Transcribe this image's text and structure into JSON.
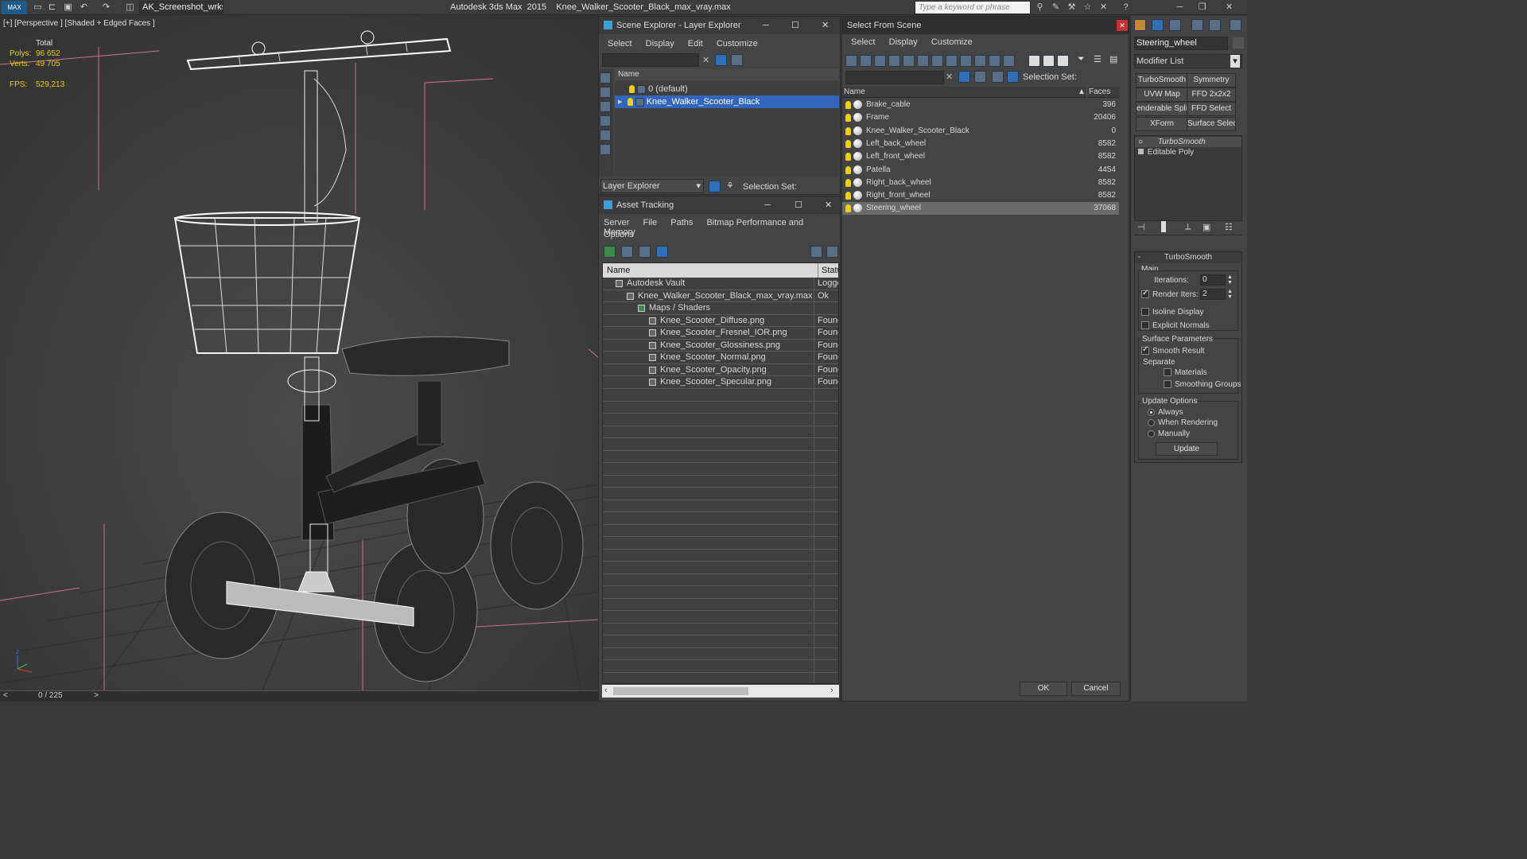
{
  "app": {
    "title": "Autodesk 3ds Max  2015    Knee_Walker_Scooter_Black_max_vray.max",
    "workspace": "AK_Screenshot_wrksp",
    "search_placeholder": "Type a keyword or phrase"
  },
  "viewport": {
    "label": "[+] [Perspective ] [Shaded + Edged Faces ]",
    "stats": {
      "total_label": "Total",
      "polys_label": "Polys:",
      "polys_value": "96 652",
      "verts_label": "Verts:",
      "verts_value": "49 705",
      "fps_label": "FPS:",
      "fps_value": "529,213"
    }
  },
  "timeline": {
    "frame": "0 / 225",
    "prev": "<",
    "next": ">"
  },
  "scene_explorer": {
    "title": "Scene Explorer - Layer Explorer",
    "menu": [
      "Select",
      "Display",
      "Edit",
      "Customize"
    ],
    "column": "Name",
    "layers": [
      "0 (default)",
      "Knee_Walker_Scooter_Black"
    ],
    "footer_dropdown": "Layer Explorer",
    "selection_set_label": "Selection Set:"
  },
  "asset_tracking": {
    "title": "Asset Tracking",
    "menu1": [
      "Server",
      "File",
      "Paths",
      "Bitmap Performance and Memory"
    ],
    "menu2": [
      "Options"
    ],
    "col_name": "Name",
    "col_status": "Status",
    "rows": [
      {
        "name": "Autodesk Vault",
        "status": "Logged"
      },
      {
        "name": "Knee_Walker_Scooter_Black_max_vray.max",
        "status": "Ok"
      },
      {
        "name": "Maps / Shaders",
        "status": ""
      },
      {
        "name": "Knee_Scooter_Diffuse.png",
        "status": "Found"
      },
      {
        "name": "Knee_Scooter_Fresnel_IOR.png",
        "status": "Found"
      },
      {
        "name": "Knee_Scooter_Glossiness.png",
        "status": "Found"
      },
      {
        "name": "Knee_Scooter_Normal.png",
        "status": "Found"
      },
      {
        "name": "Knee_Scooter_Opacity.png",
        "status": "Found"
      },
      {
        "name": "Knee_Scooter_Specular.png",
        "status": "Found"
      }
    ]
  },
  "select_from_scene": {
    "title": "Select From Scene",
    "menu": [
      "Select",
      "Display",
      "Customize"
    ],
    "selection_set_label": "Selection Set:",
    "col_name": "Name",
    "col_faces": "Faces",
    "objects": [
      {
        "name": "Brake_cable",
        "faces": "396"
      },
      {
        "name": "Frame",
        "faces": "20406"
      },
      {
        "name": "Knee_Walker_Scooter_Black",
        "faces": "0"
      },
      {
        "name": "Left_back_wheel",
        "faces": "8582"
      },
      {
        "name": "Left_front_wheel",
        "faces": "8582"
      },
      {
        "name": "Patella",
        "faces": "4454"
      },
      {
        "name": "Right_back_wheel",
        "faces": "8582"
      },
      {
        "name": "Right_front_wheel",
        "faces": "8582"
      },
      {
        "name": "Steering_wheel",
        "faces": "37068"
      }
    ],
    "ok": "OK",
    "cancel": "Cancel"
  },
  "command_panel": {
    "object_name": "Steering_wheel",
    "modifier_list": "Modifier List",
    "buttons": [
      "TurboSmooth",
      "Symmetry",
      "UVW Map",
      "FFD 2x2x2",
      "enderable Splin",
      "FFD Select",
      "XForm",
      "Surface Select"
    ],
    "stack": [
      "TurboSmooth",
      "Editable Poly"
    ],
    "rollout_title": "TurboSmooth",
    "main_label": "Main",
    "iterations_label": "Iterations:",
    "iterations_value": "0",
    "render_iters_label": "Render Iters:",
    "render_iters_value": "2",
    "isoline_label": "Isoline Display",
    "explicit_normals_label": "Explicit Normals",
    "surface_params_label": "Surface Parameters",
    "smooth_result_label": "Smooth Result",
    "separate_label": "Separate",
    "materials_label": "Materials",
    "smoothing_groups_label": "Smoothing Groups",
    "update_options_label": "Update Options",
    "always_label": "Always",
    "when_rendering_label": "When Rendering",
    "manually_label": "Manually",
    "update_button": "Update"
  }
}
